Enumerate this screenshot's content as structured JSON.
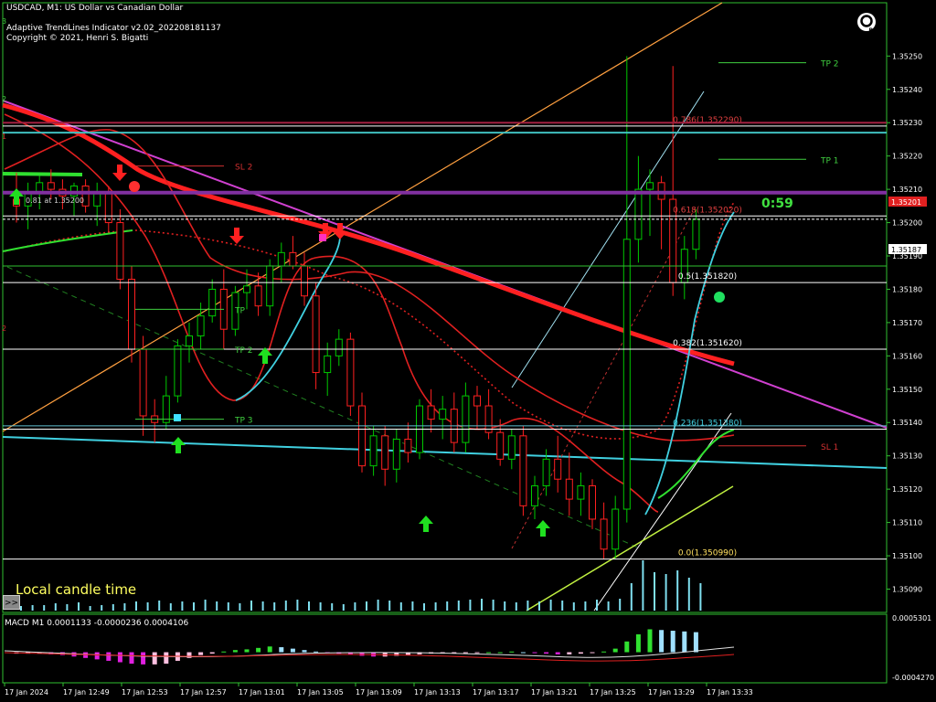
{
  "header": {
    "symbol_line": "USDCAD, M1:  US Dollar vs Canadian Dollar",
    "indicator_line": "Adaptive TrendLines Indicator v2.02_202208181137",
    "copyright_line": "Copyright © 2021, Henri S. Bigatti"
  },
  "main_panel": {
    "local_time_label": "Local candle time",
    "scroll_button": ">>",
    "countdown": "0:59",
    "bid_tag": "1.35201",
    "ask_tag": "1.35187",
    "left_label_3": "3",
    "left_label_2": "2",
    "left_label_2b": "2",
    "left_label_1": "1",
    "small_price_note": "0.81 at 1.35200",
    "fib_levels": [
      {
        "label": "0.786(1.352290)",
        "price": 1.35229
      },
      {
        "label": "0.618(1.352020)",
        "price": 1.35202
      },
      {
        "label": "0.5(1.351820)",
        "price": 1.35182
      },
      {
        "label": "0.382(1.351620)",
        "price": 1.35162
      },
      {
        "label": "0.236(1.351380)",
        "price": 1.35138
      },
      {
        "label": "0.0(1.350990)",
        "price": 1.35099
      }
    ],
    "targets": [
      {
        "label": "TP 2",
        "price": 1.35248
      },
      {
        "label": "TP 1",
        "price": 1.35219
      },
      {
        "label": "SL 1",
        "price": 1.35133
      },
      {
        "label": "SL 2",
        "price": 1.35217
      },
      {
        "label": "TP",
        "price": 1.35174
      },
      {
        "label": "TP 2",
        "price": 1.35162
      },
      {
        "label": "TP 3",
        "price": 1.35141
      }
    ]
  },
  "macd_panel": {
    "title": "MACD M1 0.0001133 -0.0000236 0.0004106",
    "axis_top": "0.0005301",
    "axis_bottom": "-0.0004270",
    "histogram": [
      -2e-05,
      -2e-05,
      -2e-05,
      -3e-05,
      -4e-05,
      -6e-05,
      -8e-05,
      -0.0001,
      -0.00012,
      -0.00014,
      -0.00016,
      -0.00017,
      -0.00017,
      -0.00016,
      -0.00012,
      -8e-05,
      -4e-05,
      -2e-05,
      1e-05,
      3e-05,
      4e-05,
      6e-05,
      8e-05,
      7e-05,
      5e-05,
      3e-05,
      1e-05,
      -1e-05,
      -2e-05,
      -3e-05,
      -5e-05,
      -6e-05,
      -6e-05,
      -5e-05,
      -4e-05,
      -3e-05,
      -2e-05,
      -2e-05,
      -1e-05,
      -1e-05,
      -1e-05,
      0,
      0,
      1e-05,
      0,
      -1e-05,
      -2e-05,
      -3e-05,
      -3e-05,
      -2e-05,
      -1e-05,
      1e-05,
      5e-05,
      0.00015,
      0.00025,
      0.00032,
      0.00031,
      0.0003,
      0.00029,
      0.00028
    ]
  },
  "chart_data": {
    "type": "candlestick",
    "symbol": "USDCAD",
    "timeframe": "M1",
    "ylim": [
      1.35083,
      1.35266
    ],
    "price_ticks": [
      "1.35250",
      "1.35240",
      "1.35230",
      "1.35220",
      "1.35210",
      "1.35200",
      "1.35190",
      "1.35180",
      "1.35170",
      "1.35160",
      "1.35150",
      "1.35140",
      "1.35130",
      "1.35120",
      "1.35110",
      "1.35100",
      "1.35090"
    ],
    "time_ticks": [
      "17 Jan 2024",
      "17 Jan 12:49",
      "17 Jan 12:53",
      "17 Jan 12:57",
      "17 Jan 13:01",
      "17 Jan 13:05",
      "17 Jan 13:09",
      "17 Jan 13:13",
      "17 Jan 13:17",
      "17 Jan 13:21",
      "17 Jan 13:25",
      "17 Jan 13:29",
      "17 Jan 13:33"
    ],
    "ohlc": [
      [
        1.35207,
        1.35215,
        1.352,
        1.35205
      ],
      [
        1.35205,
        1.35212,
        1.35198,
        1.35209
      ],
      [
        1.35209,
        1.35214,
        1.35204,
        1.35212
      ],
      [
        1.35212,
        1.35216,
        1.35207,
        1.3521
      ],
      [
        1.3521,
        1.35213,
        1.35204,
        1.35208
      ],
      [
        1.35208,
        1.35212,
        1.35202,
        1.35211
      ],
      [
        1.35211,
        1.35213,
        1.35203,
        1.35205
      ],
      [
        1.35205,
        1.35212,
        1.35199,
        1.35209
      ],
      [
        1.35209,
        1.35211,
        1.35197,
        1.352
      ],
      [
        1.352,
        1.35204,
        1.3518,
        1.35183
      ],
      [
        1.35183,
        1.35187,
        1.35158,
        1.35162
      ],
      [
        1.35162,
        1.35166,
        1.35136,
        1.35142
      ],
      [
        1.35142,
        1.35147,
        1.35134,
        1.3514
      ],
      [
        1.3514,
        1.35154,
        1.35138,
        1.35148
      ],
      [
        1.35148,
        1.35165,
        1.35146,
        1.35163
      ],
      [
        1.35163,
        1.3517,
        1.35158,
        1.35166
      ],
      [
        1.35166,
        1.35176,
        1.35162,
        1.35172
      ],
      [
        1.35172,
        1.35183,
        1.3517,
        1.3518
      ],
      [
        1.3518,
        1.35186,
        1.35162,
        1.35168
      ],
      [
        1.35168,
        1.35181,
        1.35166,
        1.35179
      ],
      [
        1.35179,
        1.35186,
        1.35174,
        1.35181
      ],
      [
        1.35181,
        1.35185,
        1.35172,
        1.35175
      ],
      [
        1.35175,
        1.35189,
        1.35172,
        1.35187
      ],
      [
        1.35187,
        1.35194,
        1.35182,
        1.35191
      ],
      [
        1.35191,
        1.35196,
        1.35186,
        1.35187
      ],
      [
        1.35187,
        1.35191,
        1.35175,
        1.35178
      ],
      [
        1.35178,
        1.35182,
        1.3515,
        1.35155
      ],
      [
        1.35155,
        1.35164,
        1.35148,
        1.3516
      ],
      [
        1.3516,
        1.35168,
        1.35157,
        1.35165
      ],
      [
        1.35165,
        1.35167,
        1.35142,
        1.35145
      ],
      [
        1.35145,
        1.35149,
        1.35125,
        1.35127
      ],
      [
        1.35127,
        1.35139,
        1.35124,
        1.35136
      ],
      [
        1.35136,
        1.35139,
        1.35121,
        1.35126
      ],
      [
        1.35126,
        1.35138,
        1.35122,
        1.35135
      ],
      [
        1.35135,
        1.3514,
        1.35128,
        1.35131
      ],
      [
        1.35131,
        1.35147,
        1.35129,
        1.35145
      ],
      [
        1.35145,
        1.3515,
        1.35137,
        1.35141
      ],
      [
        1.35141,
        1.35148,
        1.35135,
        1.35144
      ],
      [
        1.35144,
        1.35149,
        1.35131,
        1.35134
      ],
      [
        1.35134,
        1.35152,
        1.35131,
        1.35148
      ],
      [
        1.35148,
        1.35151,
        1.35138,
        1.35145
      ],
      [
        1.35145,
        1.3515,
        1.35135,
        1.35137
      ],
      [
        1.35137,
        1.35141,
        1.35127,
        1.35129
      ],
      [
        1.35129,
        1.35138,
        1.35126,
        1.35136
      ],
      [
        1.35136,
        1.35139,
        1.35112,
        1.35115
      ],
      [
        1.35115,
        1.35124,
        1.35111,
        1.35121
      ],
      [
        1.35121,
        1.35132,
        1.35118,
        1.35129
      ],
      [
        1.35129,
        1.35136,
        1.35119,
        1.35123
      ],
      [
        1.35123,
        1.35131,
        1.35112,
        1.35117
      ],
      [
        1.35117,
        1.35125,
        1.35112,
        1.35121
      ],
      [
        1.35121,
        1.35123,
        1.35108,
        1.35111
      ],
      [
        1.35111,
        1.35116,
        1.35099,
        1.35102
      ],
      [
        1.35102,
        1.35118,
        1.35099,
        1.35114
      ],
      [
        1.35114,
        1.3525,
        1.3511,
        1.35195
      ],
      [
        1.35195,
        1.3522,
        1.35188,
        1.3521
      ],
      [
        1.3521,
        1.35216,
        1.35196,
        1.35212
      ],
      [
        1.35212,
        1.35214,
        1.35192,
        1.35207
      ],
      [
        1.35207,
        1.35247,
        1.35178,
        1.35182
      ],
      [
        1.35182,
        1.35196,
        1.35177,
        1.35192
      ],
      [
        1.35192,
        1.35204,
        1.35189,
        1.35201
      ]
    ]
  },
  "colors": {
    "bull_candle": "#00c800",
    "bear_candle": "#ff2020",
    "fib_line": "#ffffff",
    "trend_magenta": "#d040d0",
    "ma_red": "#ff2020",
    "ma_green": "#30e030",
    "cyan_line": "#40d0e0",
    "orange_line": "#ffa040",
    "macd_up": "#30e030",
    "macd_down": "#e020e0",
    "macd_bar": "#a0e0ff"
  }
}
